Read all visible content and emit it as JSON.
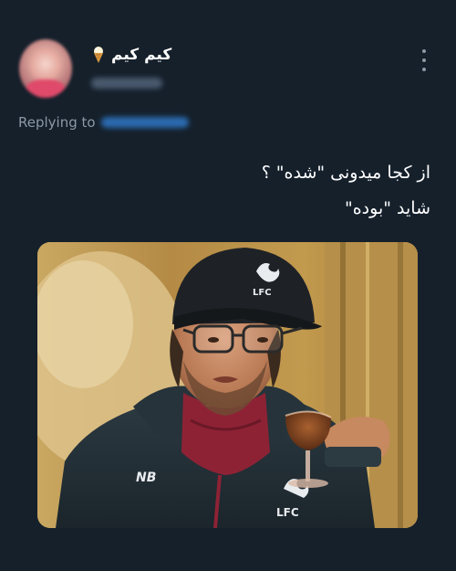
{
  "tweet": {
    "author": {
      "display_name": "کیم کیم",
      "name_emoji_icon": "ice-cream-icon",
      "avatar_icon": "avatar-photo",
      "handle_blurred": true
    },
    "reply_prefix": "Replying to",
    "reply_mention_blurred": true,
    "body_lines": [
      "از کجا میدونی \"شده\" ؟",
      "شاید \"بوده\""
    ],
    "media": {
      "type": "photo",
      "cap_badge": "LFC",
      "jacket_logo": "LFC",
      "sponsor_mark": "NB",
      "subject_icon": "man-with-wine-glass"
    }
  },
  "colors": {
    "background": "#15202b",
    "secondary_text": "#8b98a5",
    "mention": "#1d9bf0",
    "liverpool_red": "#c8102e"
  }
}
